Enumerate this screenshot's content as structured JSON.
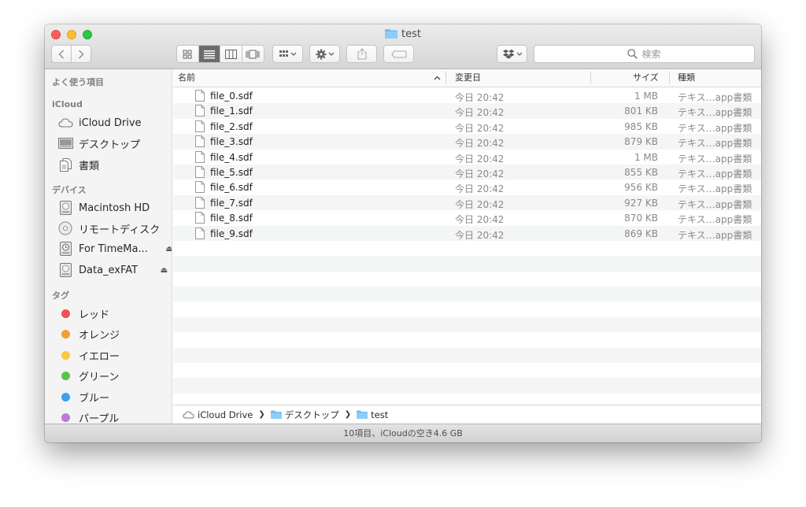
{
  "window": {
    "title": "test"
  },
  "toolbar": {
    "back_icon": "chevron-left-icon",
    "forward_icon": "chevron-right-icon",
    "view_modes": [
      "icon-view",
      "list-view",
      "column-view",
      "coverflow-view"
    ],
    "active_view": "list-view",
    "search_placeholder": "検索"
  },
  "sidebar": {
    "favorites_heading": "よく使う項目",
    "icloud_heading": "iCloud",
    "icloud_items": [
      {
        "label": "iCloud Drive",
        "icon": "cloud-icon"
      },
      {
        "label": "デスクトップ",
        "icon": "desktop-icon"
      },
      {
        "label": "書類",
        "icon": "documents-icon"
      }
    ],
    "devices_heading": "デバイス",
    "device_items": [
      {
        "label": "Macintosh HD",
        "icon": "harddrive-icon"
      },
      {
        "label": "リモートディスク",
        "icon": "disc-icon"
      },
      {
        "label": "For TimeMa...",
        "icon": "timemachine-drive-icon",
        "eject": "⏏"
      },
      {
        "label": "Data_exFAT",
        "icon": "external-drive-icon",
        "eject": "⏏"
      }
    ],
    "tags_heading": "タグ",
    "tag_items": [
      {
        "label": "レッド",
        "color": "#f0524f"
      },
      {
        "label": "オレンジ",
        "color": "#f59d38"
      },
      {
        "label": "イエロー",
        "color": "#f7c93c"
      },
      {
        "label": "グリーン",
        "color": "#5bc44e"
      },
      {
        "label": "ブルー",
        "color": "#3d9ff0"
      },
      {
        "label": "パープル",
        "color": "#c078d6"
      }
    ]
  },
  "list": {
    "columns": {
      "name": "名前",
      "date": "変更日",
      "size": "サイズ",
      "kind": "種類"
    },
    "sort_indicator": "^",
    "files": [
      {
        "name": "file_0.sdf",
        "date": "今日 20:42",
        "size": "1 MB",
        "kind": "テキス…app書類"
      },
      {
        "name": "file_1.sdf",
        "date": "今日 20:42",
        "size": "801 KB",
        "kind": "テキス…app書類"
      },
      {
        "name": "file_2.sdf",
        "date": "今日 20:42",
        "size": "985 KB",
        "kind": "テキス…app書類"
      },
      {
        "name": "file_3.sdf",
        "date": "今日 20:42",
        "size": "879 KB",
        "kind": "テキス…app書類"
      },
      {
        "name": "file_4.sdf",
        "date": "今日 20:42",
        "size": "1 MB",
        "kind": "テキス…app書類"
      },
      {
        "name": "file_5.sdf",
        "date": "今日 20:42",
        "size": "855 KB",
        "kind": "テキス…app書類"
      },
      {
        "name": "file_6.sdf",
        "date": "今日 20:42",
        "size": "956 KB",
        "kind": "テキス…app書類"
      },
      {
        "name": "file_7.sdf",
        "date": "今日 20:42",
        "size": "927 KB",
        "kind": "テキス…app書類"
      },
      {
        "name": "file_8.sdf",
        "date": "今日 20:42",
        "size": "870 KB",
        "kind": "テキス…app書類"
      },
      {
        "name": "file_9.sdf",
        "date": "今日 20:42",
        "size": "869 KB",
        "kind": "テキス…app書類"
      }
    ]
  },
  "pathbar": {
    "crumbs": [
      {
        "label": "iCloud Drive",
        "icon": "cloud-icon"
      },
      {
        "label": "デスクトップ",
        "icon": "folder-icon"
      },
      {
        "label": "test",
        "icon": "folder-icon"
      }
    ],
    "separator": "❯"
  },
  "statusbar": {
    "text": "10項目、iCloudの空き4.6 GB"
  }
}
